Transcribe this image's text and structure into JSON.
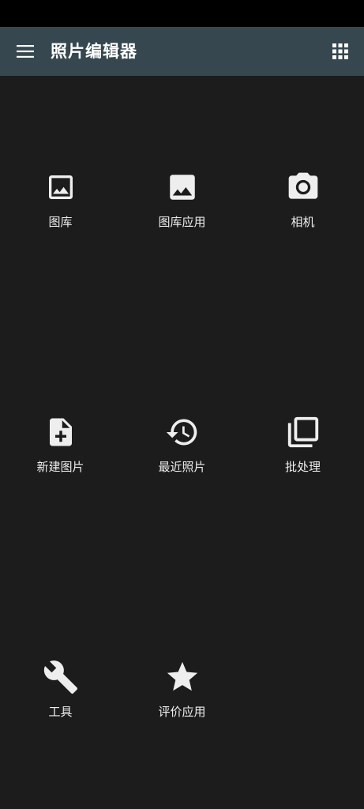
{
  "app_bar": {
    "title": "照片编辑器",
    "menu_icon": "menu-icon",
    "apps_icon": "apps-grid-icon",
    "background": "#36474f"
  },
  "tiles": [
    {
      "label": "图库",
      "icon": "image-outline-icon"
    },
    {
      "label": "图库应用",
      "icon": "image-icon"
    },
    {
      "label": "相机",
      "icon": "camera-icon"
    },
    {
      "label": "新建图片",
      "icon": "new-file-icon"
    },
    {
      "label": "最近照片",
      "icon": "history-icon"
    },
    {
      "label": "批处理",
      "icon": "batch-library-icon"
    },
    {
      "label": "工具",
      "icon": "wrench-icon"
    },
    {
      "label": "评价应用",
      "icon": "star-icon"
    }
  ]
}
